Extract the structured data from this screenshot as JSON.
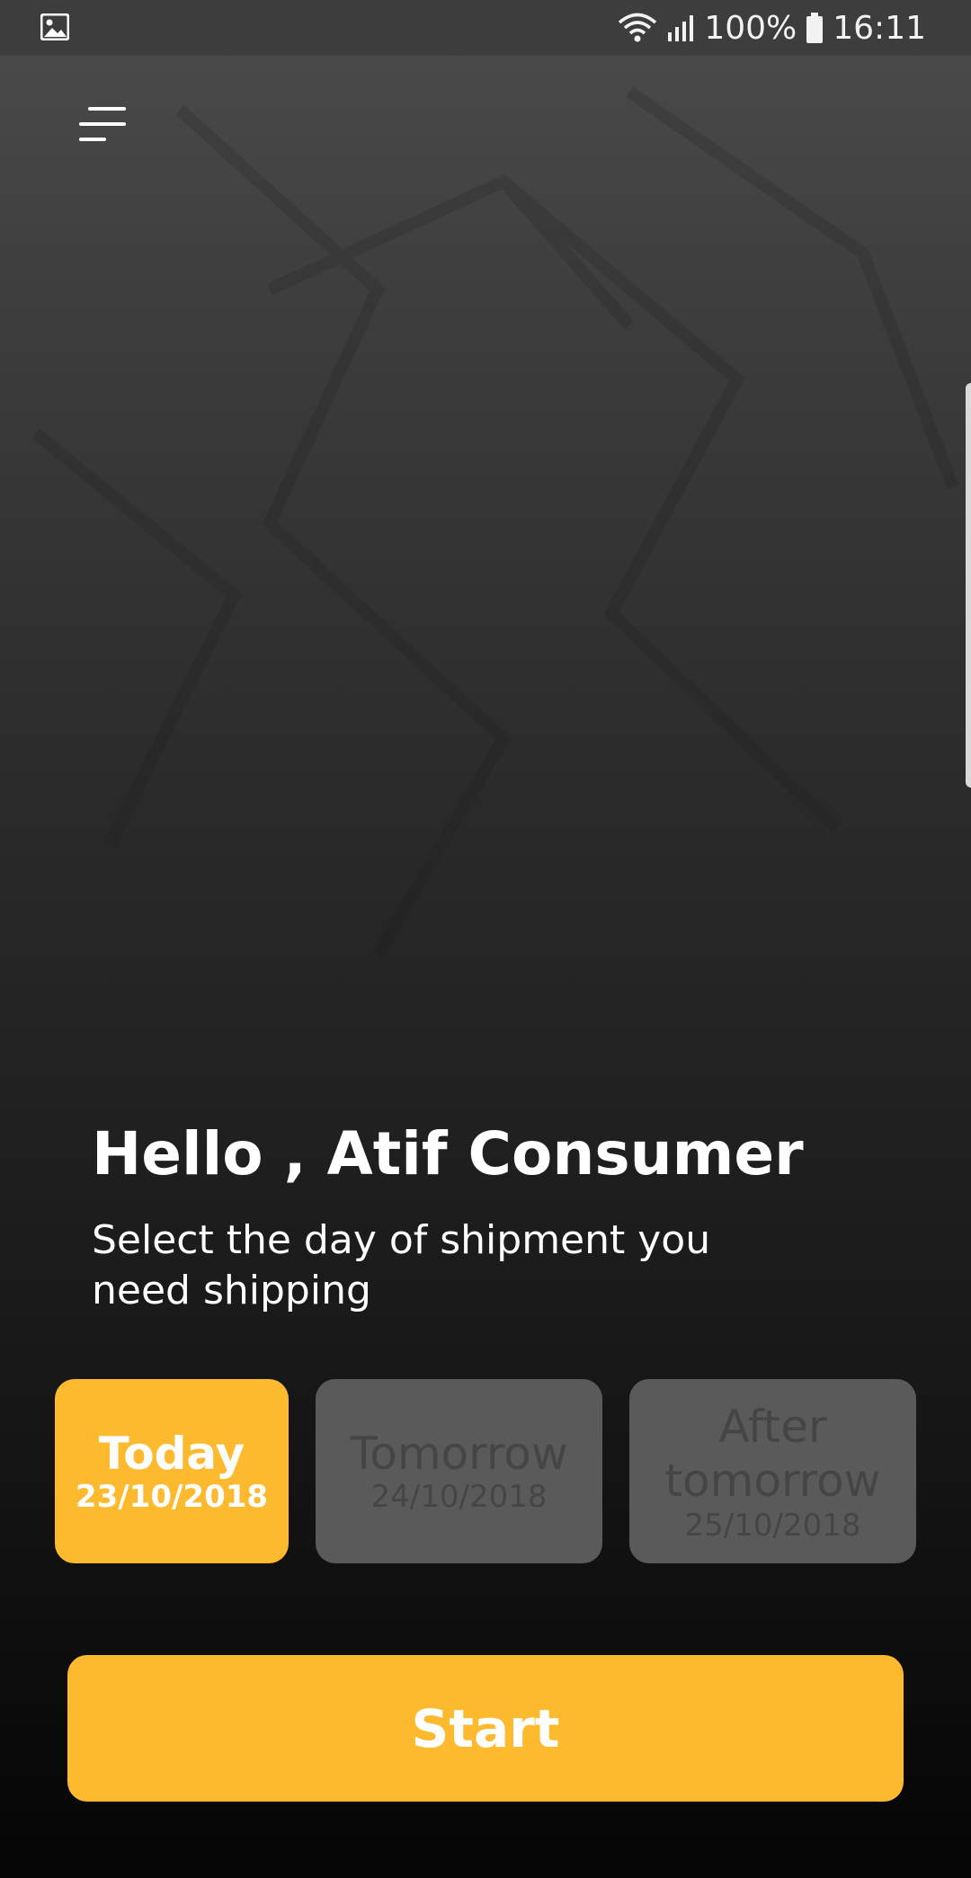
{
  "status_bar": {
    "left_icon": "gallery-icon",
    "wifi_icon": "wifi-icon",
    "signal_icon": "signal-icon",
    "battery_percent": "100%",
    "battery_icon": "battery-icon",
    "time": "16:11"
  },
  "header": {
    "menu_icon": "menu-icon"
  },
  "greeting": {
    "title": "Hello , Atif Consumer",
    "subtitle": "Select the day of shipment you need shipping"
  },
  "day_options": [
    {
      "label": "Today",
      "date": "23/10/2018",
      "selected": true
    },
    {
      "label": "Tomorrow",
      "date": "24/10/2018",
      "selected": false
    },
    {
      "label": "After tomorrow",
      "date": "25/10/2018",
      "selected": false
    }
  ],
  "start_button": {
    "label": "Start"
  },
  "colors": {
    "accent": "#fdba2e",
    "unselected_card": "#5a5a5a",
    "unselected_text": "#454545",
    "status_bar": "#3d3d3d"
  }
}
